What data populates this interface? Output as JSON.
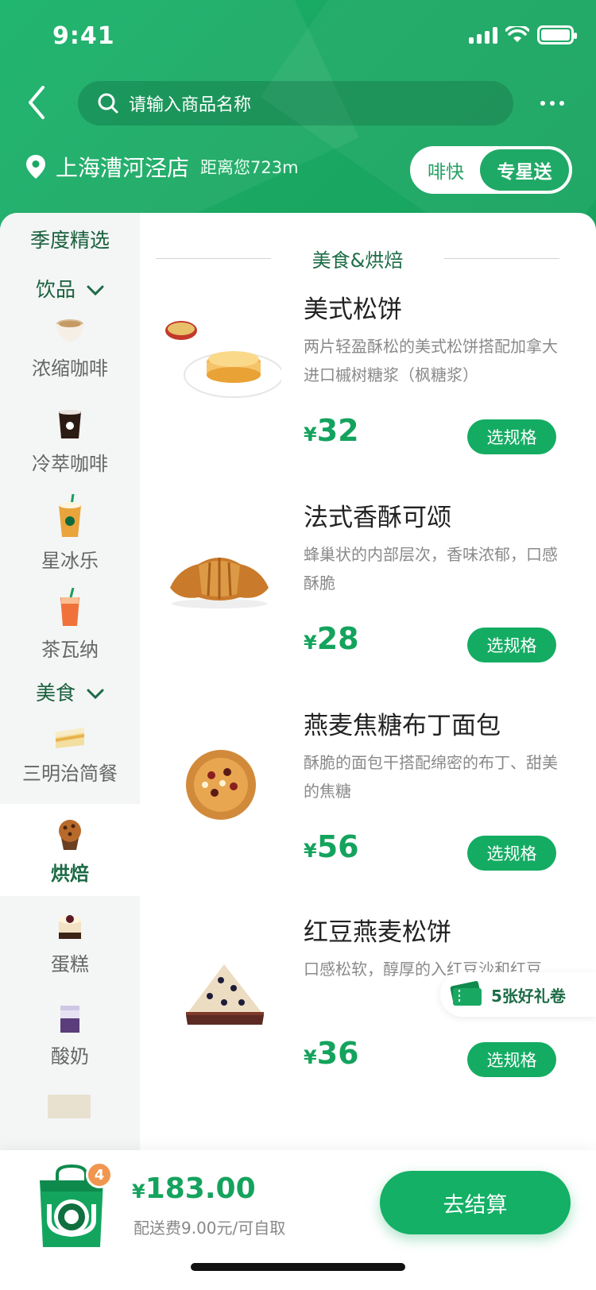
{
  "status": {
    "time": "9:41"
  },
  "header": {
    "search_placeholder": "请输入商品名称",
    "store_name": "上海漕河泾店",
    "distance": "距离您723m",
    "toggle": {
      "fast": "啡快",
      "star": "专星送"
    }
  },
  "sidebar": {
    "season": "季度精选",
    "drinks_header": "饮品",
    "espresso": "浓缩咖啡",
    "cold_brew": "冷萃咖啡",
    "frappuccino": "星冰乐",
    "teavana": "茶瓦纳",
    "food_header": "美食",
    "sandwich": "三明治简餐",
    "bakery": "烘焙",
    "cake": "蛋糕",
    "yogurt": "酸奶"
  },
  "section": {
    "title": "美食&烘焙"
  },
  "products": [
    {
      "name": "美式松饼",
      "desc": "两片轻盈酥松的美式松饼搭配加拿大进口槭树糖浆（枫糖浆）",
      "yen": "¥",
      "price": "32",
      "button": "选规格"
    },
    {
      "name": "法式香酥可颂",
      "desc": "蜂巢状的内部层次，香味浓郁，口感酥脆",
      "yen": "¥",
      "price": "28",
      "button": "选规格"
    },
    {
      "name": "燕麦焦糖布丁面包",
      "desc": "酥脆的面包干搭配绵密的布丁、甜美的焦糖",
      "yen": "¥",
      "price": "56",
      "button": "选规格"
    },
    {
      "name": "红豆燕麦松饼",
      "desc": "口感松软，醇厚的入红豆沙和红豆",
      "yen": "¥",
      "price": "36",
      "button": "选规格"
    }
  ],
  "coupon": {
    "label": "5张好礼卷"
  },
  "cart": {
    "badge": "4",
    "yen": "¥",
    "total": "183.00",
    "fee": "配送费9.00元/可自取",
    "checkout": "去结算"
  }
}
